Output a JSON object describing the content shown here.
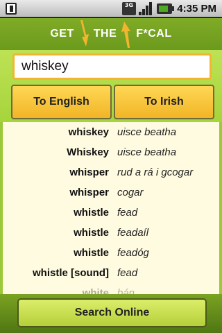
{
  "status_bar": {
    "network": "3G",
    "time": "4:35 PM"
  },
  "header": {
    "logo_word1": "GET",
    "logo_word2": "THE",
    "logo_word3": "F*CAL"
  },
  "search": {
    "value": "whiskey"
  },
  "buttons": {
    "to_english": "To English",
    "to_irish": "To Irish",
    "search_online": "Search Online"
  },
  "results": [
    {
      "english": "whiskey",
      "irish": "uisce beatha"
    },
    {
      "english": "Whiskey",
      "irish": "uisce beatha"
    },
    {
      "english": "whisper",
      "irish": "rud a rá i gcogar"
    },
    {
      "english": "whisper",
      "irish": "cogar"
    },
    {
      "english": "whistle",
      "irish": "fead"
    },
    {
      "english": "whistle",
      "irish": "feadaíl"
    },
    {
      "english": "whistle",
      "irish": "feadóg"
    },
    {
      "english": "whistle [sound]",
      "irish": "fead"
    },
    {
      "english": "white",
      "irish": "bán"
    }
  ],
  "colors": {
    "header_green": "#7fab27",
    "accent_yellow": "#f1b526",
    "list_background": "#fffbe0"
  }
}
